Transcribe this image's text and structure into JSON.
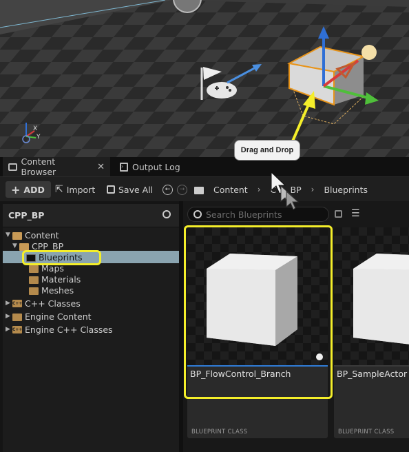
{
  "viewport": {
    "axis_x": "X",
    "axis_y": "Y"
  },
  "annotation": {
    "tooltip": "Drag and Drop",
    "color": "#f4ee2a"
  },
  "tabs": [
    {
      "label": "Content Browser",
      "icon": "content-browser-icon",
      "active": true
    },
    {
      "label": "Output Log",
      "icon": "output-log-icon",
      "active": false
    }
  ],
  "toolbar": {
    "add_label": "ADD",
    "import_label": "Import",
    "save_all_label": "Save All",
    "breadcrumb": [
      "Content",
      "CPP_BP",
      "Blueprints"
    ],
    "breadcrumb_partial": "C",
    "breadcrumb_partial_tail": "_BP"
  },
  "sources": {
    "title": "CPP_BP",
    "tree": {
      "content": "Content",
      "cpp_bp": "CPP_BP",
      "blueprints": "Blueprints",
      "maps": "Maps",
      "materials": "Materials",
      "meshes": "Meshes",
      "cpp_classes": "C++ Classes",
      "engine_content": "Engine Content",
      "engine_cpp_classes": "Engine C++ Classes"
    }
  },
  "search": {
    "placeholder": "Search Blueprints"
  },
  "assets": [
    {
      "name": "BP_FlowControl_Branch",
      "type": "BLUEPRINT CLASS"
    },
    {
      "name": "BP_SampleActor",
      "type": "BLUEPRINT CLASS"
    }
  ],
  "colors": {
    "selection": "#2f7bd6",
    "folder": "#b48a4c",
    "axis_x": "#d93a3a",
    "axis_y": "#4fbf3a",
    "axis_z": "#2f6fd6"
  }
}
